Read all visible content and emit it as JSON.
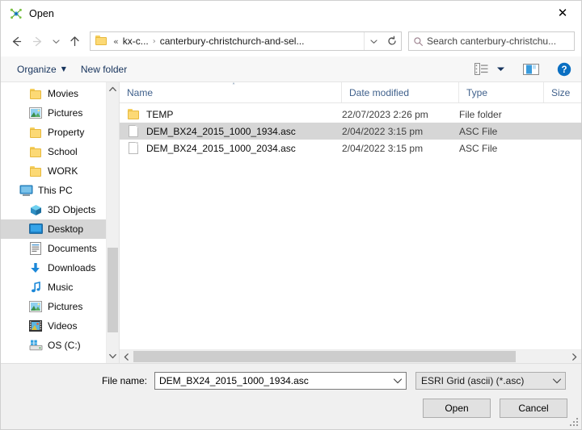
{
  "window": {
    "title": "Open",
    "icon": "qgis-app-icon",
    "close_label": "✕"
  },
  "nav": {
    "back_icon": "back-arrow-icon",
    "forward_icon": "forward-arrow-icon",
    "recent_icon": "recent-locations-chevron-icon",
    "up_icon": "up-arrow-icon",
    "refresh_icon": "refresh-icon",
    "address": {
      "folder_icon": "folder-icon",
      "overflow": "«",
      "crumbs": [
        "kx-c...",
        "canterbury-christchurch-and-sel..."
      ],
      "separator": "›",
      "dropdown_icon": "chevron-down-icon"
    },
    "search": {
      "icon": "search-icon",
      "placeholder": "Search canterbury-christchu..."
    }
  },
  "commandbar": {
    "organize_label": "Organize",
    "organize_caret": "▼",
    "new_folder_label": "New folder",
    "view_icon": "view-layout-icon",
    "view_caret": "▼",
    "preview_icon": "preview-pane-icon",
    "help_icon": "help-icon",
    "help_glyph": "?"
  },
  "sidebar": {
    "items": [
      {
        "label": "Movies",
        "icon": "folder-icon",
        "indent": 1,
        "selected": false
      },
      {
        "label": "Pictures",
        "icon": "pictures-icon",
        "indent": 1,
        "selected": false
      },
      {
        "label": "Property",
        "icon": "folder-icon",
        "indent": 1,
        "selected": false
      },
      {
        "label": "School",
        "icon": "folder-icon",
        "indent": 1,
        "selected": false
      },
      {
        "label": "WORK",
        "icon": "folder-icon",
        "indent": 1,
        "selected": false
      },
      {
        "label": "This PC",
        "icon": "this-pc-icon",
        "indent": 0,
        "selected": false
      },
      {
        "label": "3D Objects",
        "icon": "3d-objects-icon",
        "indent": 1,
        "selected": false
      },
      {
        "label": "Desktop",
        "icon": "desktop-icon",
        "indent": 1,
        "selected": true
      },
      {
        "label": "Documents",
        "icon": "documents-icon",
        "indent": 1,
        "selected": false
      },
      {
        "label": "Downloads",
        "icon": "downloads-icon",
        "indent": 1,
        "selected": false
      },
      {
        "label": "Music",
        "icon": "music-icon",
        "indent": 1,
        "selected": false
      },
      {
        "label": "Pictures",
        "icon": "pictures-icon",
        "indent": 1,
        "selected": false
      },
      {
        "label": "Videos",
        "icon": "videos-icon",
        "indent": 1,
        "selected": false
      },
      {
        "label": "OS (C:)",
        "icon": "drive-icon",
        "indent": 1,
        "selected": false
      }
    ],
    "scroll_up_icon": "chevron-up-icon",
    "scroll_down_icon": "chevron-down-icon"
  },
  "filelist": {
    "columns": [
      {
        "label": "Name",
        "sorted": "asc"
      },
      {
        "label": "Date modified",
        "sorted": ""
      },
      {
        "label": "Type",
        "sorted": ""
      },
      {
        "label": "Size",
        "sorted": ""
      }
    ],
    "sort_caret": "˄",
    "rows": [
      {
        "name": "TEMP",
        "icon": "folder-icon",
        "date_modified": "22/07/2023 2:26 pm",
        "type": "File folder",
        "size": "",
        "selected": false
      },
      {
        "name": "DEM_BX24_2015_1000_1934.asc",
        "icon": "file-icon",
        "date_modified": "2/04/2022 3:15 pm",
        "type": "ASC File",
        "size": "",
        "selected": true
      },
      {
        "name": "DEM_BX24_2015_1000_2034.asc",
        "icon": "file-icon",
        "date_modified": "2/04/2022 3:15 pm",
        "type": "ASC File",
        "size": "",
        "selected": false
      }
    ],
    "hscroll_left_icon": "chevron-left-icon",
    "hscroll_right_icon": "chevron-right-icon"
  },
  "footer": {
    "filename_label": "File name:",
    "filename_value": "DEM_BX24_2015_1000_1934.asc",
    "filename_dropdown_icon": "chevron-down-icon",
    "filter_value": "ESRI Grid (ascii) (*.asc)",
    "filter_dropdown_icon": "chevron-down-icon",
    "open_label": "Open",
    "cancel_label": "Cancel"
  },
  "colors": {
    "selection": "#d6d6d6",
    "header_text": "#40618c",
    "command_text": "#16335c",
    "accent_blue": "#0a7bd4",
    "folder_yellow": "#fcd975"
  }
}
